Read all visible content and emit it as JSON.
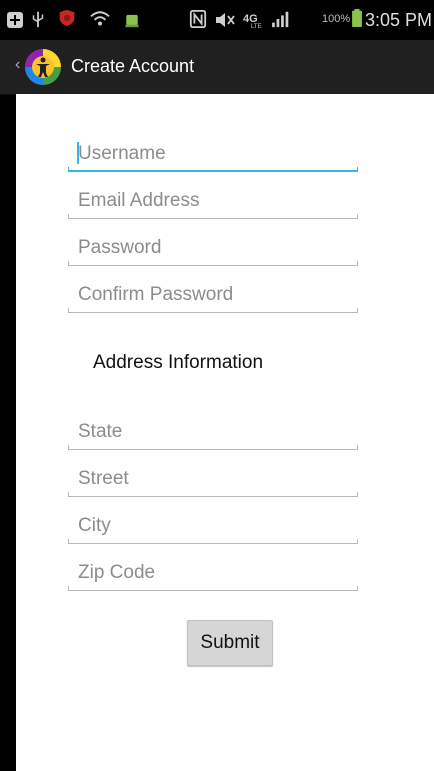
{
  "status_bar": {
    "battery_percent": "100%",
    "time": "3:05 PM",
    "icons": [
      "add-notification-icon",
      "usb-icon",
      "shield-icon",
      "wifi-hotspot-icon",
      "android-icon",
      "nfc-icon",
      "mute-icon",
      "4g-lte-icon",
      "signal-icon",
      "battery-icon"
    ]
  },
  "action_bar": {
    "title": "Create Account",
    "logo": "app-logo-icon"
  },
  "form": {
    "username_placeholder": "Username",
    "email_placeholder": "Email Address",
    "password_placeholder": "Password",
    "confirm_password_placeholder": "Confirm Password",
    "address_section_title": "Address Information",
    "state_placeholder": "State",
    "street_placeholder": "Street",
    "city_placeholder": "City",
    "zip_placeholder": "Zip Code",
    "submit_label": "Submit"
  },
  "colors": {
    "accent": "#33b5e5",
    "action_bar": "#202020",
    "status_bar": "#000000",
    "battery": "#8bc34a",
    "shield": "#c62828"
  }
}
